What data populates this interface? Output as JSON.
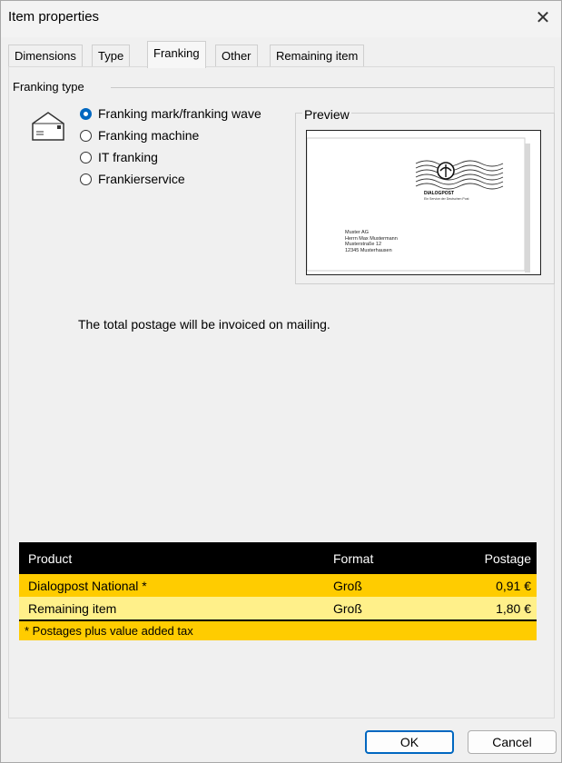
{
  "window": {
    "title": "Item properties"
  },
  "tabs": [
    {
      "label": "Dimensions"
    },
    {
      "label": "Type"
    },
    {
      "label": "Franking",
      "active": true
    },
    {
      "label": "Other"
    },
    {
      "label": "Remaining item"
    }
  ],
  "franking_type": {
    "group_label": "Franking type",
    "options": [
      {
        "label": "Franking mark/franking wave",
        "checked": true
      },
      {
        "label": "Franking machine",
        "checked": false
      },
      {
        "label": "IT franking",
        "checked": false
      },
      {
        "label": "Frankierservice",
        "checked": false
      }
    ],
    "icon": "envelope-icon"
  },
  "preview": {
    "label": "Preview",
    "brand": "DIALOGPOST",
    "brand_sub": "Ein Service der Deutschen Post",
    "address": [
      "Muster AG",
      "Herrn Max Mustermann",
      "Musterstraße 12",
      "12345 Musterhausen"
    ]
  },
  "info_text": "The total postage will be invoiced on mailing.",
  "product_table": {
    "headers": {
      "product": "Product",
      "format": "Format",
      "postage": "Postage"
    },
    "rows": [
      {
        "product": "Dialogpost National *",
        "format": "Groß",
        "postage": "0,91 €"
      },
      {
        "product": "Remaining item",
        "format": "Groß",
        "postage": "1,80 €"
      }
    ],
    "note": "* Postages plus value added tax"
  },
  "buttons": {
    "ok": "OK",
    "cancel": "Cancel"
  },
  "colors": {
    "accent": "#0067c0",
    "table_header": "#000000",
    "row_primary": "#ffcc00",
    "row_secondary": "#fff08a"
  }
}
